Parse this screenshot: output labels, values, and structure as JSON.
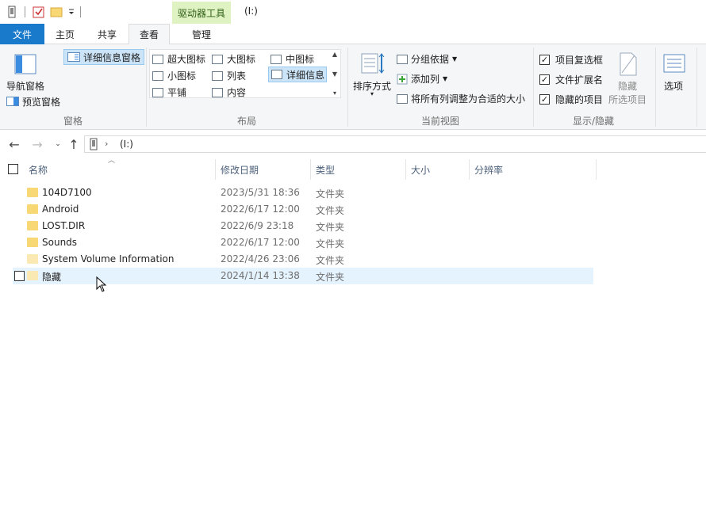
{
  "titlebar": {
    "tools_tab": "驱动器工具",
    "title": "(I:)"
  },
  "menubar": {
    "tabs": [
      "文件",
      "主页",
      "共享",
      "查看",
      "管理"
    ]
  },
  "ribbon": {
    "panes": {
      "nav_pane": "导航窗格",
      "preview_pane": "预览窗格",
      "details_pane": "详细信息窗格",
      "group_label": "窗格"
    },
    "layout": {
      "items": [
        "超大图标",
        "大图标",
        "中图标",
        "小图标",
        "列表",
        "详细信息",
        "平铺",
        "内容"
      ],
      "selected": "详细信息",
      "group_label": "布局"
    },
    "current_view": {
      "sort_by": "排序方式",
      "group_by": "分组依据",
      "add_column": "添加列",
      "fit_columns": "将所有列调整为合适的大小",
      "group_label": "当前视图"
    },
    "show_hide": {
      "item_checkboxes": "项目复选框",
      "file_extensions": "文件扩展名",
      "hidden_items": "隐藏的项目",
      "hide_selected_line1": "隐藏",
      "hide_selected_line2": "所选项目",
      "group_label": "显示/隐藏"
    },
    "options": "选项"
  },
  "address": {
    "path": "(I:)"
  },
  "columns": [
    "名称",
    "修改日期",
    "类型",
    "大小",
    "分辨率"
  ],
  "files": [
    {
      "name": "104D7100",
      "date": "2023/5/31 18:36",
      "type": "文件夹"
    },
    {
      "name": "Android",
      "date": "2022/6/17 12:00",
      "type": "文件夹"
    },
    {
      "name": "LOST.DIR",
      "date": "2022/6/9 23:18",
      "type": "文件夹"
    },
    {
      "name": "Sounds",
      "date": "2022/6/17 12:00",
      "type": "文件夹"
    },
    {
      "name": "System Volume Information",
      "date": "2022/4/26 23:06",
      "type": "文件夹"
    },
    {
      "name": "隐藏",
      "date": "2024/1/14 13:38",
      "type": "文件夹"
    }
  ],
  "colors": {
    "accent": "#1979ca",
    "tools_tab_bg": "#dff3c2",
    "hover_row": "#e5f3ff",
    "folder": "#f8d775"
  }
}
